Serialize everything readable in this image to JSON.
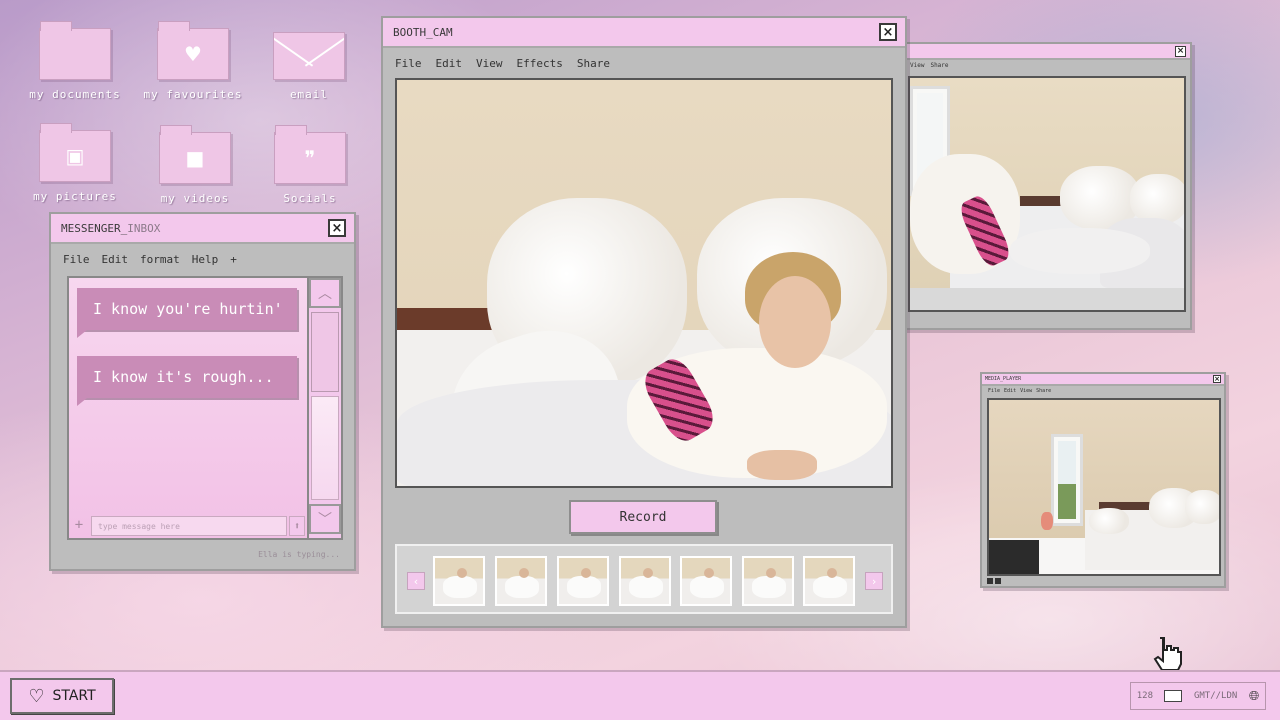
{
  "desktop": {
    "icons": [
      {
        "label": "my documents",
        "icon": "folder-icon"
      },
      {
        "label": "my favourites",
        "icon": "heart-folder-icon",
        "glyph": "♥"
      },
      {
        "label": "email",
        "icon": "envelope-icon"
      },
      {
        "label": "my pictures",
        "icon": "picture-folder-icon",
        "glyph": "▣"
      },
      {
        "label": "my videos",
        "icon": "video-folder-icon",
        "glyph": "■"
      },
      {
        "label": "Socials",
        "icon": "quote-folder-icon",
        "glyph": "❞"
      }
    ]
  },
  "booth_cam": {
    "title": "BOOTH_CAM",
    "menu": [
      "File",
      "Edit",
      "View",
      "Effects",
      "Share"
    ],
    "record_label": "Record",
    "thumbnail_count": 7
  },
  "messenger": {
    "title_main": "MESSENGER_",
    "title_dim": "INBOX",
    "menu": [
      "File",
      "Edit",
      "format",
      "Help",
      "+"
    ],
    "messages": [
      "I know you're hurtin'",
      "I know it's rough..."
    ],
    "input_placeholder": "type message here",
    "status": "Ella is typing..."
  },
  "back_window": {
    "menu": [
      "View",
      "Share"
    ]
  },
  "media_player": {
    "title": "MEDIA_PLAYER",
    "menu": [
      "File",
      "Edit",
      "View",
      "Share"
    ]
  },
  "taskbar": {
    "start_label": "START",
    "mail_count": "128",
    "timezone": "GMT//LDN"
  },
  "colors": {
    "window_pink": "#f3c8ec",
    "window_gray": "#bdbdbd",
    "bubble": "#c98cb7"
  }
}
